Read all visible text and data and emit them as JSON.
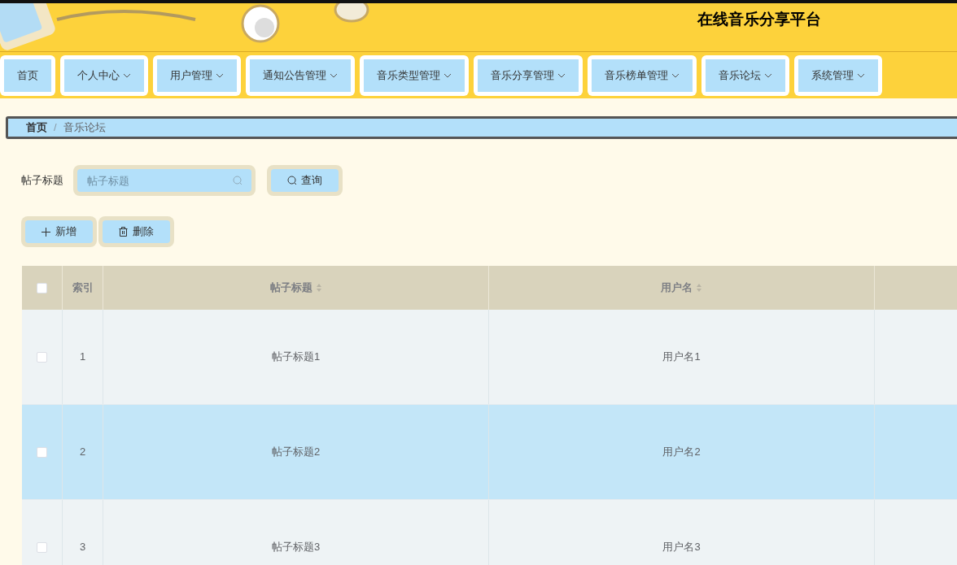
{
  "header": {
    "title": "在线音乐分享平台"
  },
  "nav": [
    {
      "label": "首页",
      "dropdown": false
    },
    {
      "label": "个人中心",
      "dropdown": true
    },
    {
      "label": "用户管理",
      "dropdown": true
    },
    {
      "label": "通知公告管理",
      "dropdown": true
    },
    {
      "label": "音乐类型管理",
      "dropdown": true
    },
    {
      "label": "音乐分享管理",
      "dropdown": true
    },
    {
      "label": "音乐榜单管理",
      "dropdown": true
    },
    {
      "label": "音乐论坛",
      "dropdown": true
    },
    {
      "label": "系统管理",
      "dropdown": true
    }
  ],
  "breadcrumb": [
    "首页",
    "音乐论坛"
  ],
  "breadcrumb_separator": "/",
  "search": {
    "label": "帖子标题",
    "placeholder": "帖子标题",
    "button": "查询"
  },
  "actions": [
    {
      "kind": "add",
      "label": "新增"
    },
    {
      "kind": "delete",
      "label": "删除"
    }
  ],
  "table": {
    "select_all": {
      "checked": false
    },
    "columns": [
      {
        "label": "索引",
        "sortable": false
      },
      {
        "label": "帖子标题",
        "sortable": true
      },
      {
        "label": "用户名",
        "sortable": true
      }
    ],
    "rows": [
      {
        "checked": false,
        "highlighted": false,
        "cells": [
          "1",
          "帖子标题1",
          "用户名1"
        ]
      },
      {
        "checked": false,
        "highlighted": true,
        "cells": [
          "2",
          "帖子标题2",
          "用户名2"
        ]
      },
      {
        "checked": false,
        "highlighted": false,
        "cells": [
          "3",
          "帖子标题3",
          "用户名3"
        ]
      }
    ]
  }
}
